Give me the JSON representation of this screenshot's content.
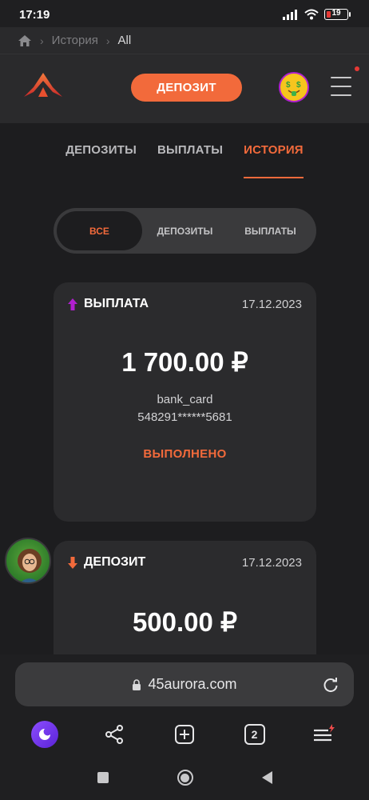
{
  "status_bar": {
    "time": "17:19",
    "battery": "19"
  },
  "breadcrumb": {
    "home_icon": "home-icon",
    "items": [
      "История",
      "All"
    ]
  },
  "header": {
    "deposit_label": "ДЕПОЗИТ",
    "accent": "#f26a3b"
  },
  "tabs": [
    {
      "label": "ДЕПОЗИТЫ",
      "active": false
    },
    {
      "label": "ВЫПЛАТЫ",
      "active": false
    },
    {
      "label": "ИСТОРИЯ",
      "active": true
    }
  ],
  "filter": [
    {
      "label": "ВСЕ",
      "active": true
    },
    {
      "label": "ДЕПОЗИТЫ",
      "active": false
    },
    {
      "label": "ВЫПЛАТЫ",
      "active": false
    }
  ],
  "transactions": [
    {
      "type": "ВЫПЛАТА",
      "direction": "up",
      "date": "17.12.2023",
      "amount": "1 700.00 ₽",
      "method": "bank_card",
      "card_number": "548291******5681",
      "status": "ВЫПОЛНЕНО"
    },
    {
      "type": "ДЕПОЗИТ",
      "direction": "down",
      "date": "17.12.2023",
      "amount": "500.00 ₽"
    }
  ],
  "browser": {
    "url": "45aurora.com",
    "tab_count": "2"
  },
  "colors": {
    "accent": "#f26a3b",
    "background": "#1d1d1f",
    "card": "#2b2b2d",
    "withdraw_arrow": "#b11fd0"
  }
}
